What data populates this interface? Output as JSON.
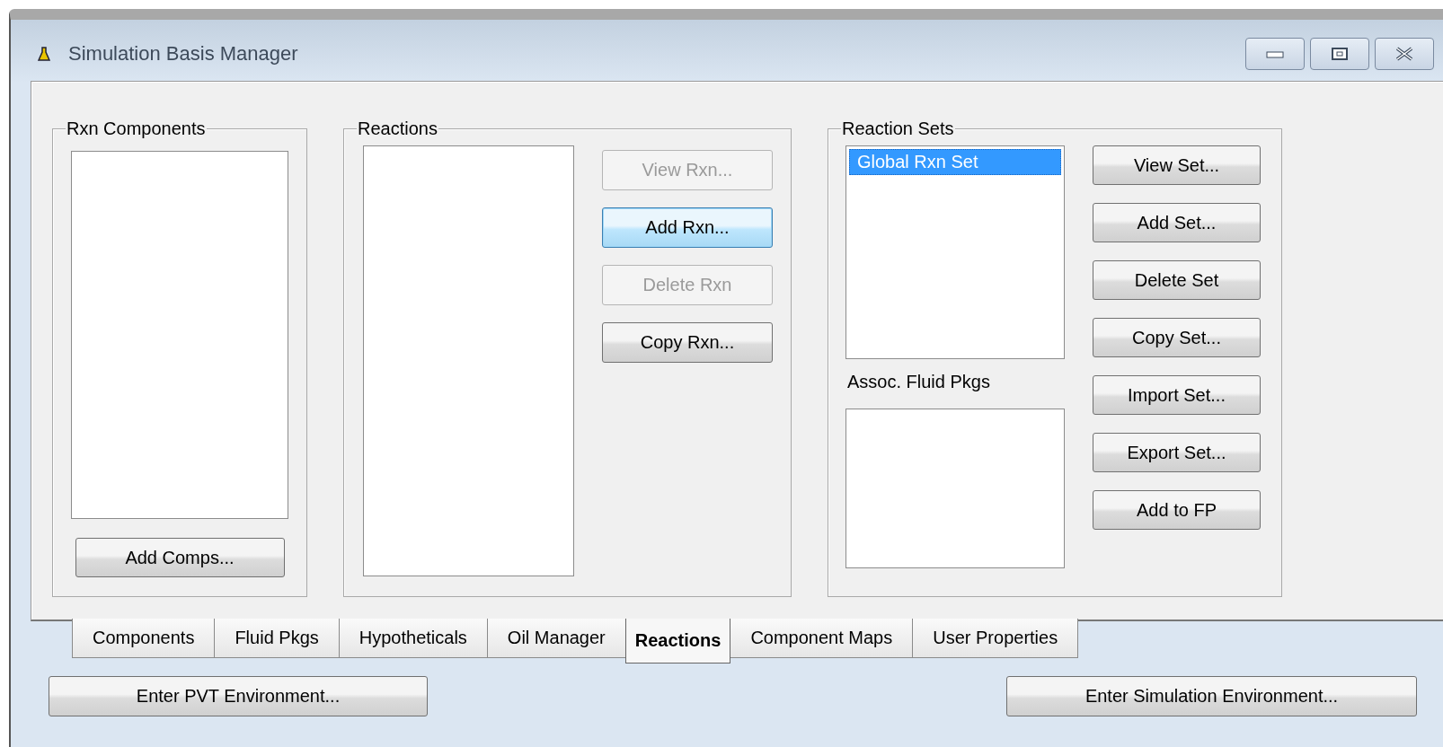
{
  "window": {
    "title": "Simulation Basis Manager"
  },
  "rxn_components": {
    "title": "Rxn Components",
    "buttons": [
      {
        "label": "Add Comps...",
        "disabled": false,
        "focused": false
      }
    ]
  },
  "reactions": {
    "title": "Reactions",
    "buttons": [
      {
        "label": "View Rxn...",
        "disabled": true,
        "focused": false
      },
      {
        "label": "Add Rxn...",
        "disabled": false,
        "focused": true
      },
      {
        "label": "Delete Rxn",
        "disabled": true,
        "focused": false
      },
      {
        "label": "Copy Rxn...",
        "disabled": false,
        "focused": false
      }
    ]
  },
  "reaction_sets": {
    "title": "Reaction Sets",
    "sets": [
      {
        "label": "Global Rxn Set",
        "selected": true
      }
    ],
    "assoc_label": "Assoc. Fluid Pkgs",
    "buttons": [
      {
        "label": "View Set...",
        "disabled": false,
        "focused": false
      },
      {
        "label": "Add Set...",
        "disabled": false,
        "focused": false
      },
      {
        "label": "Delete Set",
        "disabled": false,
        "focused": false
      },
      {
        "label": "Copy Set...",
        "disabled": false,
        "focused": false
      },
      {
        "label": "Import Set...",
        "disabled": false,
        "focused": false
      },
      {
        "label": "Export Set...",
        "disabled": false,
        "focused": false
      },
      {
        "label": "Add to FP",
        "disabled": false,
        "focused": false
      }
    ]
  },
  "tabs": [
    {
      "label": "Components",
      "selected": false
    },
    {
      "label": "Fluid Pkgs",
      "selected": false
    },
    {
      "label": "Hypotheticals",
      "selected": false
    },
    {
      "label": "Oil Manager",
      "selected": false
    },
    {
      "label": "Reactions",
      "selected": true
    },
    {
      "label": "Component Maps",
      "selected": false
    },
    {
      "label": "User Properties",
      "selected": false
    }
  ],
  "bottom_buttons": [
    {
      "label": "Enter PVT Environment..."
    },
    {
      "label": "Enter Simulation Environment..."
    }
  ]
}
